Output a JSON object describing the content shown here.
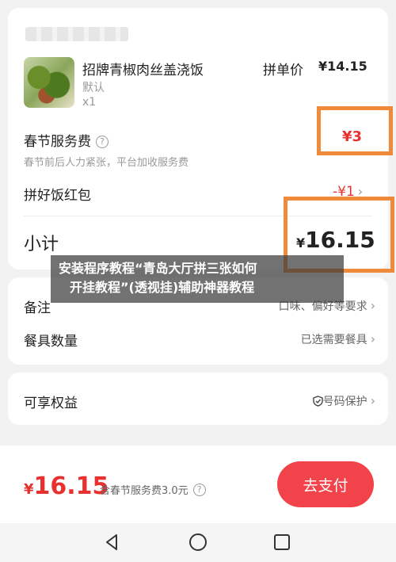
{
  "order": {
    "item_name": "招牌青椒肉丝盖浇饭",
    "item_spec": "默认",
    "item_qty": "x1",
    "price_label": "拼单价",
    "price_value": "¥14.15",
    "service_fee_label": "春节服务费",
    "service_fee_sub": "春节前后人力紧张，平台加收服务费",
    "service_fee_value": "¥3",
    "red_packet_label": "拼好饭红包",
    "red_packet_value": "-¥1",
    "subtotal_label": "小计",
    "subtotal_yen": "¥",
    "subtotal_value": "16.15"
  },
  "options": {
    "remark_label": "备注",
    "remark_value": "口味、偏好等要求",
    "utensils_label": "餐具数量",
    "utensils_value": "已选需要餐具"
  },
  "rights": {
    "label": "可享权益",
    "value": "号码保护"
  },
  "overlay": {
    "line1": "安装程序教程“青岛大厅拼三张如何",
    "line2": "开挂教程”(透视挂)辅助神器教程"
  },
  "footer": {
    "total_yen": "¥",
    "total_value": "16.15",
    "total_note": "含春节服务费3.0元",
    "pay_label": "去支付"
  },
  "colors": {
    "accent_red": "#e8312f",
    "highlight_orange": "#ee8a3a",
    "pay_button": "#f3434a"
  },
  "icons": [
    "help-circle-icon",
    "chevron-right-icon",
    "shield-check-icon",
    "back-icon",
    "home-icon",
    "recent-apps-icon"
  ]
}
